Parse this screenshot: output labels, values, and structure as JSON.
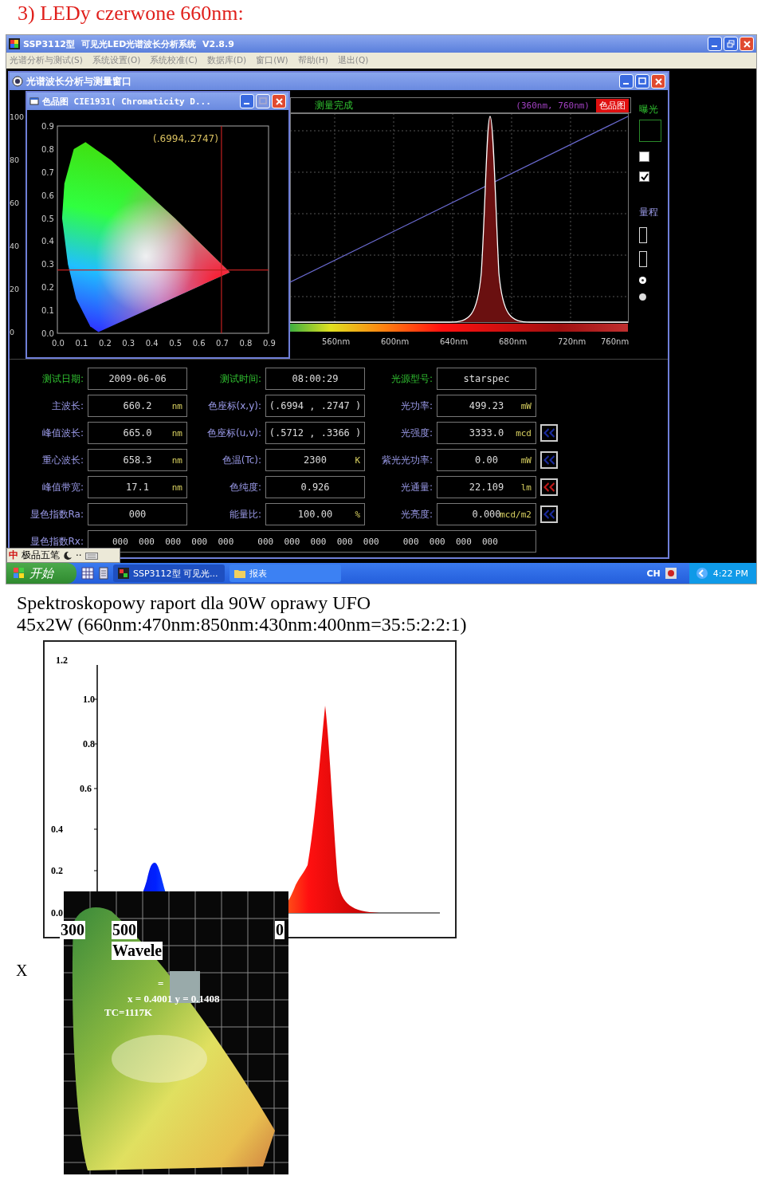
{
  "heading": "3) LEDy czerwone 660nm:",
  "app": {
    "title": "SSP3112型  可见光LED光谱波长分析系统  V2.8.9",
    "menu": [
      "光谱分析与测试(S)",
      "系统设置(O)",
      "系统校准(C)",
      "数据库(D)",
      "窗口(W)",
      "帮助(H)",
      "退出(Q)"
    ],
    "measure_window": {
      "title": "光谱波长分析与测量窗口",
      "axis_labels": [
        "100",
        "80",
        "60",
        "40",
        "20",
        "0"
      ]
    },
    "chromaticity_window": {
      "title": "色品图 CIE1931( Chromaticity D...",
      "point_label": "(.6994,.2747)",
      "y_ticks": [
        "0.9",
        "0.8",
        "0.7",
        "0.6",
        "0.5",
        "0.4",
        "0.3",
        "0.2",
        "0.1",
        "0.0"
      ],
      "x_ticks": [
        "0.0",
        "0.1",
        "0.2",
        "0.3",
        "0.4",
        "0.5",
        "0.6",
        "0.7",
        "0.8",
        "0.9"
      ]
    },
    "spectrum": {
      "status": "测量完成",
      "range": "(360nm, 760nm)",
      "mode_button": "色品图",
      "x_ticks": [
        "560nm",
        "600nm",
        "640nm",
        "680nm",
        "720nm",
        "760nm"
      ]
    },
    "side_panel": {
      "exposure_label": "曝光",
      "range_label": "量程",
      "checkboxes": [
        {
          "checked": false
        },
        {
          "checked": true
        }
      ],
      "radios": [
        {
          "selected": true
        },
        {
          "selected": false
        }
      ]
    },
    "fields": [
      {
        "kind": "info",
        "label": "测试日期:",
        "value": "2009-06-06"
      },
      {
        "kind": "info",
        "label": "测试时间:",
        "value": "08:00:29"
      },
      {
        "kind": "info",
        "label": "光源型号:",
        "value": "starspec"
      },
      {
        "kind": "measure",
        "label": "主波长:",
        "value": "660.2",
        "unit": "nm"
      },
      {
        "kind": "measure",
        "label": "色座标(x,y):",
        "value": "(.6994 , .2747 )"
      },
      {
        "kind": "measure",
        "label": "光功率:",
        "value": "499.23",
        "unit": "mW"
      },
      {
        "kind": "measure",
        "label": "峰值波长:",
        "value": "665.0",
        "unit": "nm"
      },
      {
        "kind": "measure",
        "label": "色座标(u,v):",
        "value": "(.5712 , .3366 )"
      },
      {
        "kind": "measure",
        "label": "光强度:",
        "value": "3333.0",
        "unit": "mcd",
        "color": "#1a2a9c"
      },
      {
        "kind": "measure",
        "label": "重心波长:",
        "value": "658.3",
        "unit": "nm"
      },
      {
        "kind": "measure",
        "label": "色温(Tc):",
        "value": "2300",
        "unit": "K"
      },
      {
        "kind": "measure",
        "label": "紫光光功率:",
        "value": "0.00",
        "unit": "mW",
        "color": "#1a2a9c"
      },
      {
        "kind": "measure",
        "label": "峰值带宽:",
        "value": "17.1",
        "unit": "nm"
      },
      {
        "kind": "measure",
        "label": "色纯度:",
        "value": "0.926"
      },
      {
        "kind": "measure",
        "label": "光通量:",
        "value": "22.109",
        "unit": "lm",
        "color": "#c01818"
      },
      {
        "kind": "measure",
        "label": "显色指数Ra:",
        "value": "000"
      },
      {
        "kind": "measure",
        "label": "能量比:",
        "value": "100.00",
        "unit": "%"
      },
      {
        "kind": "measure",
        "label": "光亮度:",
        "value": "0.000",
        "unit": "mcd/m2",
        "color": "#1a2a9c"
      }
    ],
    "rx": {
      "label": "显色指数Rx:",
      "values": [
        "000  000  000  000  000",
        "000  000  000  000  000",
        "000  000  000  000"
      ]
    },
    "ime_bar": {
      "mode": "中",
      "name": "极品五笔",
      "punctuation": "··"
    },
    "taskbar": {
      "start": "开始",
      "tasks": [
        {
          "label": "SSP3112型 可见光...",
          "selected": true
        },
        {
          "label": "报表",
          "selected": false
        }
      ],
      "language": "CH",
      "clock": "4:22 PM"
    }
  },
  "caption": [
    "Spektroskopowy raport dla 90W oprawy UFO",
    "45x2W (660nm:470nm:850nm:430nm:400nm=35:5:2:2:1)"
  ],
  "report_chart": {
    "y_ticks": [
      "1.2",
      "1.0",
      "0.8",
      "0.6",
      "0.4",
      "0.2",
      "0.0"
    ],
    "x_labels": [
      "300",
      "500",
      "0"
    ],
    "xlabel": "Wavele"
  },
  "axis_mark": "X",
  "inset_image": {
    "lines": [
      "=",
      "x = 0.4001 y = 0.1408",
      "TC=1117K"
    ]
  }
}
